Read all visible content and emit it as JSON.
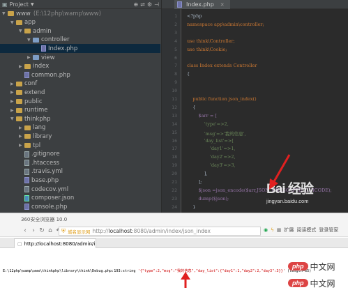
{
  "project_panel": {
    "title": "Project",
    "tree": [
      {
        "label": "www",
        "hint": "(E:\\12php\\wamp\\www)",
        "kind": "folder",
        "expanded": true,
        "depth": 0
      },
      {
        "label": "app",
        "kind": "folder",
        "expanded": true,
        "depth": 1
      },
      {
        "label": "admin",
        "kind": "folder",
        "expanded": true,
        "depth": 2
      },
      {
        "label": "controller",
        "kind": "folder",
        "expanded": true,
        "depth": 3
      },
      {
        "label": "Index.php",
        "kind": "php",
        "depth": 4,
        "selected": true
      },
      {
        "label": "view",
        "kind": "folder",
        "expanded": false,
        "depth": 3
      },
      {
        "label": "index",
        "kind": "folder",
        "expanded": false,
        "depth": 2
      },
      {
        "label": "common.php",
        "kind": "php",
        "depth": 2
      },
      {
        "label": "conf",
        "kind": "folder",
        "expanded": false,
        "depth": 1
      },
      {
        "label": "extend",
        "kind": "folder",
        "expanded": false,
        "depth": 1
      },
      {
        "label": "public",
        "kind": "folder",
        "expanded": false,
        "depth": 1
      },
      {
        "label": "runtime",
        "kind": "folder",
        "expanded": false,
        "depth": 1
      },
      {
        "label": "thinkphp",
        "kind": "folder",
        "expanded": true,
        "depth": 1
      },
      {
        "label": "lang",
        "kind": "folder",
        "expanded": false,
        "depth": 2
      },
      {
        "label": "library",
        "kind": "folder",
        "expanded": false,
        "depth": 2
      },
      {
        "label": "tpl",
        "kind": "folder",
        "expanded": false,
        "depth": 2
      },
      {
        "label": ".gitignore",
        "kind": "file",
        "depth": 2
      },
      {
        "label": ".htaccess",
        "kind": "file",
        "depth": 2
      },
      {
        "label": ".travis.yml",
        "kind": "file",
        "depth": 2
      },
      {
        "label": "base.php",
        "kind": "php",
        "depth": 2
      },
      {
        "label": "codecov.yml",
        "kind": "file",
        "depth": 2
      },
      {
        "label": "composer.json",
        "kind": "json",
        "depth": 2
      },
      {
        "label": "console.php",
        "kind": "php",
        "depth": 2
      }
    ]
  },
  "editor": {
    "tab_label": "Index.php",
    "line_numbers": [
      "1",
      "2",
      "3",
      "4",
      "5",
      "6",
      "7",
      "8",
      "9",
      "10",
      "11",
      "12",
      "13",
      "14",
      "15",
      "16",
      "17",
      "18",
      "19",
      "20",
      "21",
      "22",
      "23",
      "24",
      "25"
    ],
    "code": [
      "<?php",
      "namespace app\\admin\\controller;",
      "",
      "use think\\Controller;",
      "use think\\Cookie;",
      "",
      "class Index extends Controller",
      "{",
      "",
      "",
      "    public function json_index()",
      "    {",
      "        $arr = [",
      "            'type'=>2,",
      "            'msg'=>'我的信息',",
      "            'day_list'=>[",
      "                'day1'=>1,",
      "                'day2'=>2,",
      "                'day3'=>3,",
      "            ],",
      "        ];",
      "        $json =json_encode($arr,JSON_UNESCAPED_UNICODE);",
      "        dump($json);",
      "    }"
    ]
  },
  "watermark": {
    "logo": "Bai 经验",
    "url": "jingyan.baidu.com"
  },
  "browser": {
    "title": "360安全浏览器 10.0",
    "site_badge": "城名显示网",
    "url_prefix": "http://",
    "url_host": "localhost",
    "url_rest": ":8080/admin/index/json_index",
    "tab_label": "http://localhost:8080/admin/i",
    "right_items": [
      "扩展",
      "阅读模式",
      "登录管家"
    ],
    "output_path": "E:\\12php\\wamp\\www\\thinkphp\\library\\think\\Debug.php:193:string",
    "output_value": "'{\"type\":2,\"msg\":\"我的信息\",\"day_list\":{\"day1\":1,\"day2\":2,\"day3\":3}}'",
    "output_length": "(length=65)"
  },
  "badges": [
    {
      "oval": "php",
      "cn": "中文网"
    },
    {
      "oval": "php",
      "cn": "中文网"
    }
  ],
  "colors": {
    "ide_bg": "#2b2b2b",
    "panel_bg": "#3c3f41",
    "keyword": "#cc7832",
    "string": "#6a8759",
    "variable": "#9876aa",
    "arrow": "#e02020",
    "browser_green": "#19a34a"
  }
}
